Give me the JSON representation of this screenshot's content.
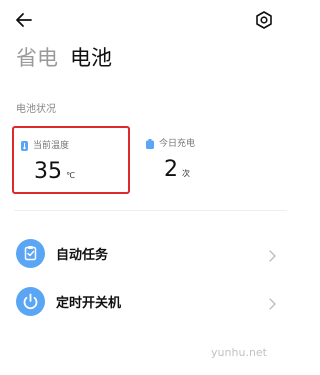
{
  "header": {
    "back_icon": "arrow-left-icon",
    "settings_icon": "gear-icon"
  },
  "tabs": [
    {
      "label": "省电"
    },
    {
      "label": "电池"
    }
  ],
  "battery_status": {
    "section_label": "电池状况",
    "temperature": {
      "label": "当前温度",
      "value": "35",
      "unit": "℃",
      "icon": "thermometer-icon"
    },
    "charges_today": {
      "label": "今日充电",
      "value": "2",
      "unit": "次",
      "icon": "battery-icon"
    }
  },
  "list": [
    {
      "label": "自动任务",
      "icon": "clipboard-icon"
    },
    {
      "label": "定时开关机",
      "icon": "power-icon"
    }
  ],
  "watermark": "yunhu.net",
  "colors": {
    "accent_blue": "#5aa6f5",
    "highlight_red": "#e02a2a"
  }
}
